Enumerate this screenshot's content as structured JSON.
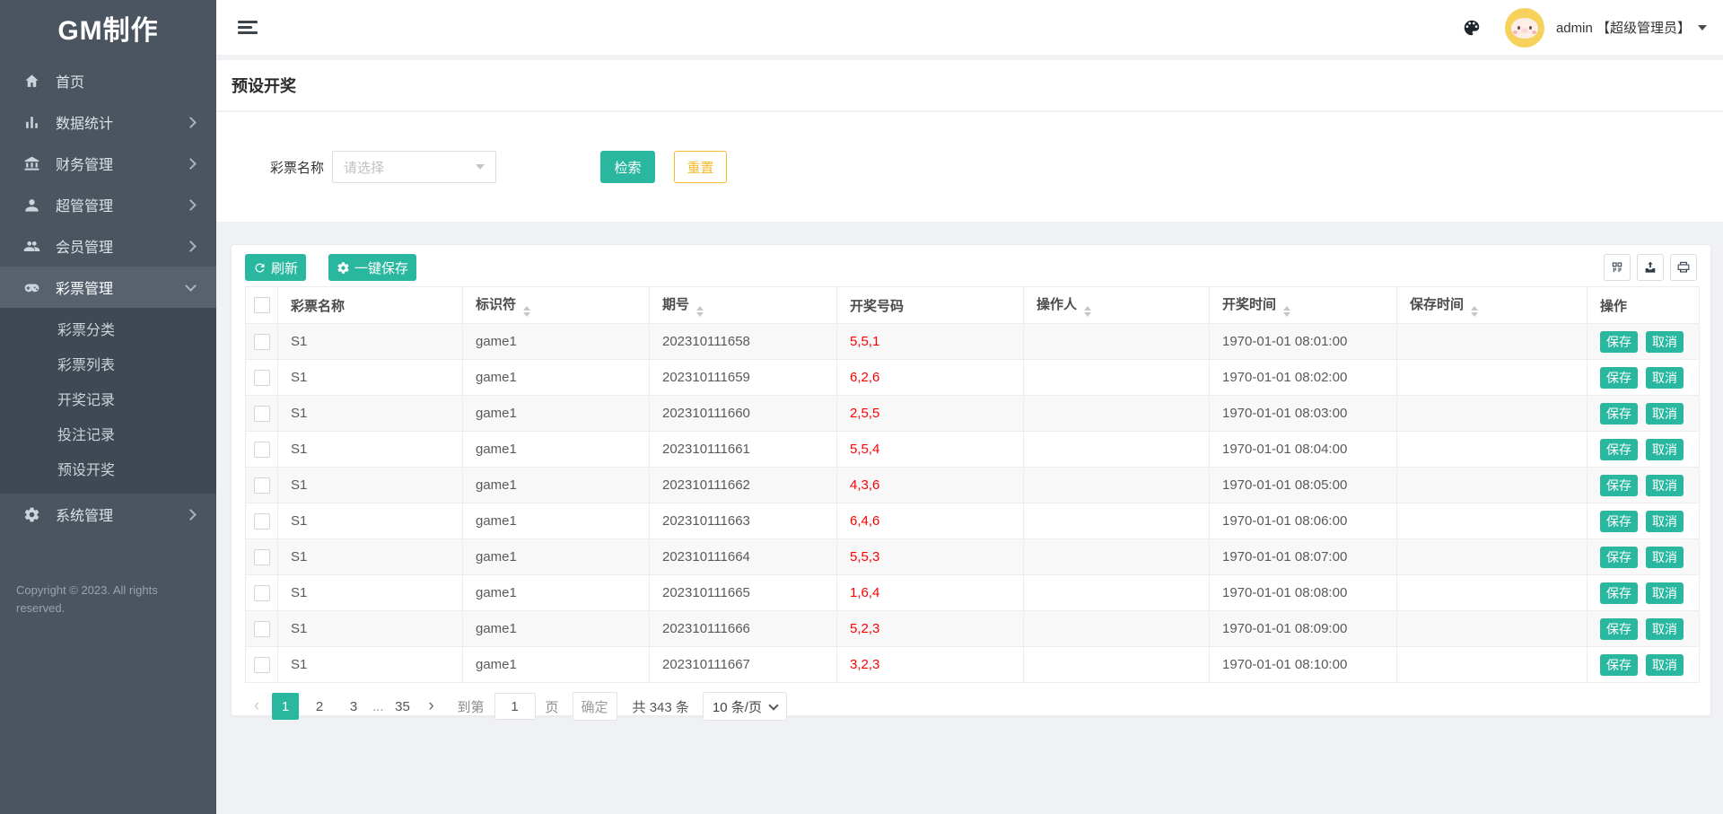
{
  "colors": {
    "teal": "#2ab7a0",
    "amber": "#f7ba2a",
    "red": "#ff0000",
    "sidebar": "#4a5560",
    "sidebar_active": "#57626e",
    "submenu": "#3f4954"
  },
  "app": {
    "logo": "GM制作"
  },
  "sidebar": {
    "items": [
      {
        "id": "home",
        "label": "首页",
        "icon": "home-icon",
        "chevron": ""
      },
      {
        "id": "stats",
        "label": "数据统计",
        "icon": "chart-icon",
        "chevron": "right"
      },
      {
        "id": "finance",
        "label": "财务管理",
        "icon": "bank-icon",
        "chevron": "right"
      },
      {
        "id": "superadmin",
        "label": "超管管理",
        "icon": "user-icon",
        "chevron": "right"
      },
      {
        "id": "members",
        "label": "会员管理",
        "icon": "users-icon",
        "chevron": "right"
      },
      {
        "id": "lottery",
        "label": "彩票管理",
        "icon": "gamepad-icon",
        "chevron": "down",
        "active": true,
        "children": [
          {
            "id": "lottery-category",
            "label": "彩票分类"
          },
          {
            "id": "lottery-list",
            "label": "彩票列表"
          },
          {
            "id": "draw-records",
            "label": "开奖记录"
          },
          {
            "id": "bet-records",
            "label": "投注记录"
          },
          {
            "id": "preset-draw",
            "label": "预设开奖"
          }
        ]
      },
      {
        "id": "system",
        "label": "系统管理",
        "icon": "gear-icon",
        "chevron": "right"
      }
    ],
    "copyright": "Copyright © 2023. All rights reserved."
  },
  "topbar": {
    "user": "admin 【超级管理员】"
  },
  "page": {
    "title": "预设开奖"
  },
  "filter": {
    "label": "彩票名称",
    "placeholder": "请选择",
    "search_label": "检索",
    "reset_label": "重置"
  },
  "toolbar": {
    "refresh_label": "刷新",
    "save_all_label": "一键保存",
    "icon_buttons": [
      {
        "icon": "columns-icon"
      },
      {
        "icon": "export-icon"
      },
      {
        "icon": "print-icon"
      }
    ]
  },
  "table": {
    "columns": [
      {
        "id": "select",
        "label": "",
        "checkbox": true,
        "sortable": false
      },
      {
        "id": "name",
        "label": "彩票名称",
        "sortable": false
      },
      {
        "id": "code",
        "label": "标识符",
        "sortable": true
      },
      {
        "id": "issue",
        "label": "期号",
        "sortable": true
      },
      {
        "id": "numbers",
        "label": "开奖号码",
        "sortable": false
      },
      {
        "id": "operator",
        "label": "操作人",
        "sortable": true
      },
      {
        "id": "draw_time",
        "label": "开奖时间",
        "sortable": true
      },
      {
        "id": "save_time",
        "label": "保存时间",
        "sortable": true
      },
      {
        "id": "actions",
        "label": "操作",
        "sortable": false
      }
    ],
    "action_labels": {
      "save": "保存",
      "cancel": "取消"
    },
    "rows": [
      {
        "name": "S1",
        "code": "game1",
        "issue": "202310111658",
        "numbers": "5,5,1",
        "operator": "",
        "draw_time": "1970-01-01 08:01:00",
        "save_time": ""
      },
      {
        "name": "S1",
        "code": "game1",
        "issue": "202310111659",
        "numbers": "6,2,6",
        "operator": "",
        "draw_time": "1970-01-01 08:02:00",
        "save_time": ""
      },
      {
        "name": "S1",
        "code": "game1",
        "issue": "202310111660",
        "numbers": "2,5,5",
        "operator": "",
        "draw_time": "1970-01-01 08:03:00",
        "save_time": ""
      },
      {
        "name": "S1",
        "code": "game1",
        "issue": "202310111661",
        "numbers": "5,5,4",
        "operator": "",
        "draw_time": "1970-01-01 08:04:00",
        "save_time": ""
      },
      {
        "name": "S1",
        "code": "game1",
        "issue": "202310111662",
        "numbers": "4,3,6",
        "operator": "",
        "draw_time": "1970-01-01 08:05:00",
        "save_time": ""
      },
      {
        "name": "S1",
        "code": "game1",
        "issue": "202310111663",
        "numbers": "6,4,6",
        "operator": "",
        "draw_time": "1970-01-01 08:06:00",
        "save_time": ""
      },
      {
        "name": "S1",
        "code": "game1",
        "issue": "202310111664",
        "numbers": "5,5,3",
        "operator": "",
        "draw_time": "1970-01-01 08:07:00",
        "save_time": ""
      },
      {
        "name": "S1",
        "code": "game1",
        "issue": "202310111665",
        "numbers": "1,6,4",
        "operator": "",
        "draw_time": "1970-01-01 08:08:00",
        "save_time": ""
      },
      {
        "name": "S1",
        "code": "game1",
        "issue": "202310111666",
        "numbers": "5,2,3",
        "operator": "",
        "draw_time": "1970-01-01 08:09:00",
        "save_time": ""
      },
      {
        "name": "S1",
        "code": "game1",
        "issue": "202310111667",
        "numbers": "3,2,3",
        "operator": "",
        "draw_time": "1970-01-01 08:10:00",
        "save_time": ""
      }
    ]
  },
  "pagination": {
    "prev": "‹",
    "next": "›",
    "pages": [
      "1",
      "2",
      "3",
      "...",
      "35"
    ],
    "active_page": "1",
    "goto_label": "到第",
    "goto_value": "1",
    "page_word": "页",
    "confirm_label": "确定",
    "total_label": "共 343 条",
    "per_page_label": "10 条/页"
  }
}
